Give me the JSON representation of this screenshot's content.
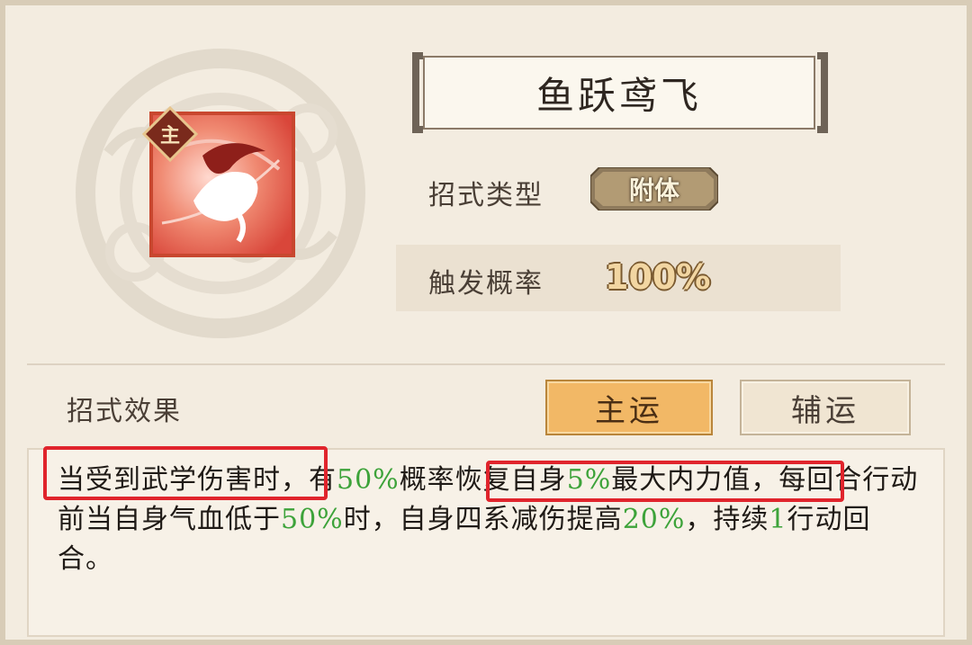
{
  "skill": {
    "title": "鱼跃鸢飞",
    "badge": "主",
    "icon": "leaping-fish-icon"
  },
  "type_row": {
    "label": "招式类型",
    "value": "附体"
  },
  "rate_row": {
    "label": "触发概率",
    "value": "100%"
  },
  "effect": {
    "label": "招式效果",
    "tabs": {
      "main": "主运",
      "aux": "辅运"
    },
    "segments": [
      {
        "t": "当受到武学伤害时，有"
      },
      {
        "t": "50%",
        "hl": true
      },
      {
        "t": "概率恢复自身"
      },
      {
        "t": "5%",
        "hl": true
      },
      {
        "t": "最大内力值，每回合行动前当自身气血低于"
      },
      {
        "t": "50%",
        "hl": true
      },
      {
        "t": "时，自身四系减伤提高"
      },
      {
        "t": "20%",
        "hl": true
      },
      {
        "t": "，持续"
      },
      {
        "t": "1",
        "hl": true
      },
      {
        "t": "行动回合。"
      }
    ]
  },
  "colors": {
    "highlight_green": "#3da33a",
    "annotation_red": "#e0242c",
    "main_tab": "#f2b866"
  }
}
